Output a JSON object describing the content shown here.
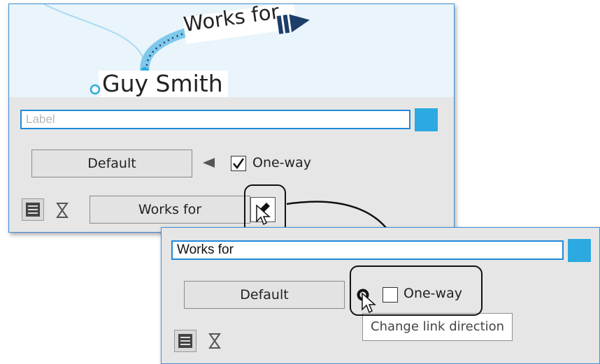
{
  "map": {
    "link_label": "Works for",
    "node_label": "Guy Smith"
  },
  "panel1": {
    "label_placeholder": "Label",
    "style_button": "Default",
    "oneway_label": "One-way",
    "oneway_checked": true,
    "link_name_button": "Works for"
  },
  "panel2": {
    "label_value": "Works for",
    "style_button": "Default",
    "oneway_label": "One-way",
    "oneway_checked": false,
    "tooltip": "Change link direction"
  },
  "colors": {
    "accent": "#2ca9e0",
    "link": "#7ec8ec",
    "window_border": "#3e8fd6",
    "panel_bg": "#e6e6e6"
  }
}
